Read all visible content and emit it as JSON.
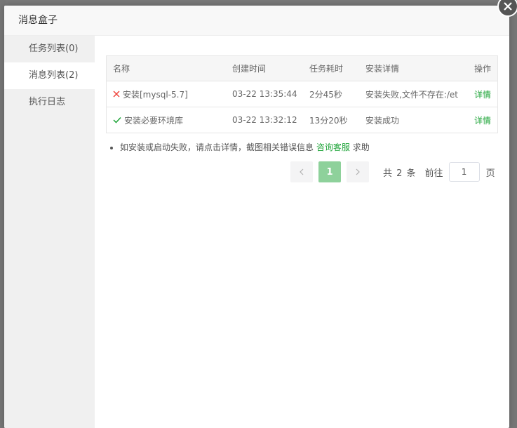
{
  "dialog": {
    "title": "消息盒子"
  },
  "sidebar": {
    "items": [
      {
        "label": "任务列表(0)",
        "active": false
      },
      {
        "label": "消息列表(2)",
        "active": true
      },
      {
        "label": "执行日志",
        "active": false
      }
    ]
  },
  "table": {
    "headers": [
      "名称",
      "创建时间",
      "任务耗时",
      "安装详情",
      "操作"
    ],
    "rows": [
      {
        "status_icon": "cross-icon",
        "name": "安装[mysql-5.7]",
        "created": "03-22 13:35:44",
        "duration": "2分45秒",
        "detail": "安装失败,文件不存在:/et",
        "detail_status": "error",
        "action": "详情"
      },
      {
        "status_icon": "check-icon",
        "name": "安装必要环境库",
        "created": "03-22 13:32:12",
        "duration": "13分20秒",
        "detail": "安装成功",
        "detail_status": "success",
        "action": "详情"
      }
    ]
  },
  "hint": {
    "text_before": "如安装或启动失败，请点击详情，截图相关错误信息",
    "link": "咨询客服",
    "text_after": "求助"
  },
  "pagination": {
    "current": "1",
    "total_text": "共 2 条",
    "goto_label": "前往",
    "goto_value": "1",
    "page_unit": "页"
  },
  "colors": {
    "accent": "#20a53a",
    "error": "#ef3e36",
    "active_page": "#8ed19b"
  }
}
